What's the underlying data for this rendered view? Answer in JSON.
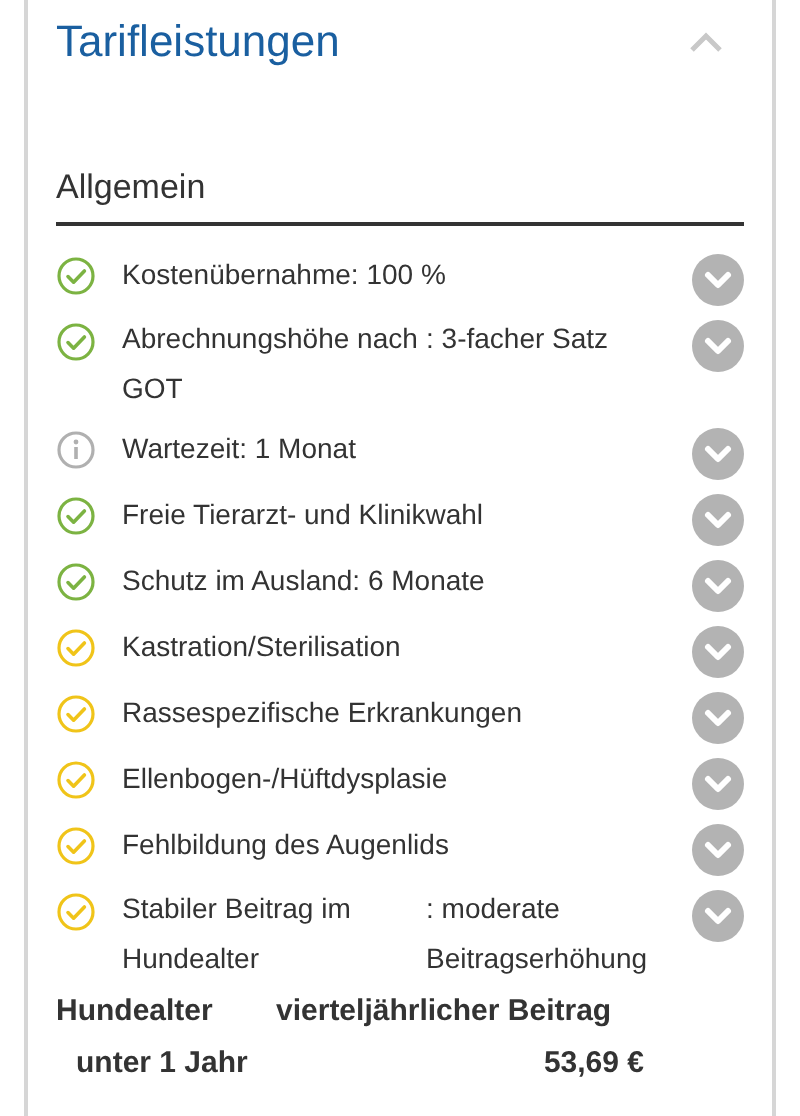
{
  "title": "Tarifleistungen",
  "expanded": true,
  "section": "Allgemein",
  "items": [
    {
      "kind": "check",
      "color": "#7cb342",
      "label": "Kostenübernahme: 100 %"
    },
    {
      "kind": "check",
      "color": "#7cb342",
      "label": "Abrechnungshöhe nach GOT",
      "value": ": 3-facher Satz"
    },
    {
      "kind": "info",
      "color": "#b0b0b0",
      "label": "Wartezeit: 1 Monat"
    },
    {
      "kind": "check",
      "color": "#7cb342",
      "label": "Freie Tierarzt- und Klinikwahl"
    },
    {
      "kind": "check",
      "color": "#7cb342",
      "label": "Schutz im Ausland: 6 Monate"
    },
    {
      "kind": "check",
      "color": "#f0c419",
      "label": "Kastration/Sterilisation"
    },
    {
      "kind": "check",
      "color": "#f0c419",
      "label": "Rassespezifische Erkrankungen"
    },
    {
      "kind": "check",
      "color": "#f0c419",
      "label": "Ellenbogen-/Hüftdysplasie"
    },
    {
      "kind": "check",
      "color": "#f0c419",
      "label": "Fehlbildung des Augenlids"
    },
    {
      "kind": "check",
      "color": "#f0c419",
      "label": "Stabiler Beitrag im Hundealter",
      "value": ": moderate Beitragserhöhung"
    }
  ],
  "table": {
    "columns": [
      "Hundealter",
      "vierteljährlicher Beitrag"
    ],
    "rows": [
      [
        "unter 1 Jahr",
        "53,69 €"
      ]
    ]
  }
}
